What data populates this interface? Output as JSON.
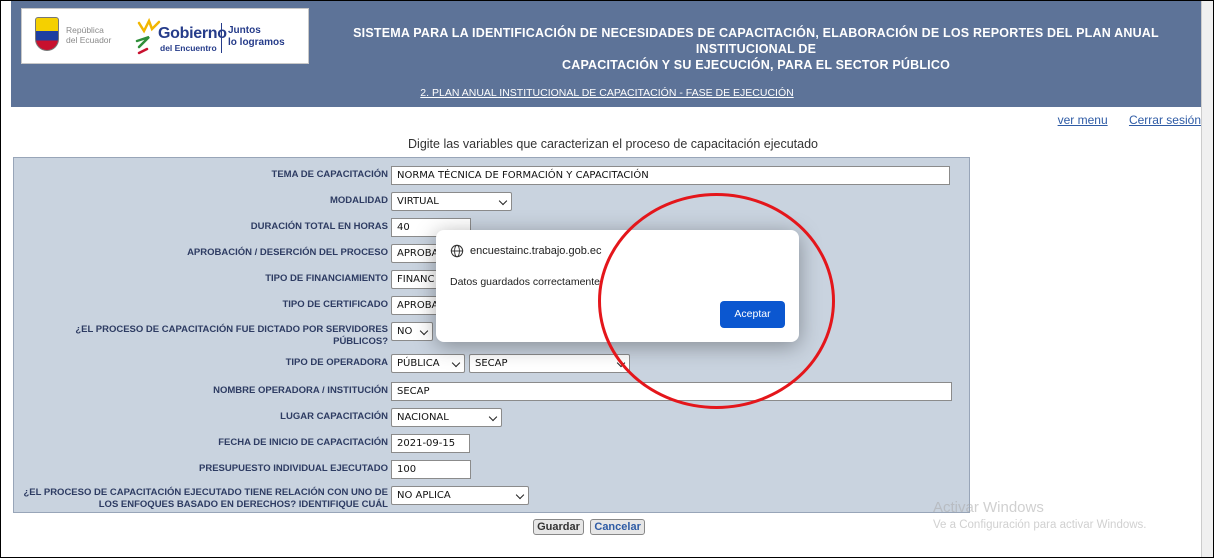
{
  "header": {
    "logo_republica": "República",
    "logo_ecuador": "del Ecuador",
    "logo_gobierno": "Gobierno",
    "logo_encuentro": "del Encuentro",
    "logo_juntos": "Juntos",
    "logo_logramos": "lo logramos",
    "title_line1": "SISTEMA PARA LA IDENTIFICACIÓN DE NECESIDADES DE CAPACITACIÓN, ELABORACIÓN DE LOS REPORTES DEL PLAN ANUAL INSTITUCIONAL DE",
    "title_line2": "CAPACITACIÓN Y SU EJECUCIÓN, PARA EL SECTOR PÚBLICO",
    "phase_link": "2. PLAN ANUAL INSTITUCIONAL DE CAPACITACIÓN - FASE DE EJECUCIÓN"
  },
  "nav": {
    "ver_menu": "ver menu",
    "cerrar_sesion": "Cerrar sesión"
  },
  "instruction": "Digite las variables que caracterizan el proceso de capacitación ejecutado",
  "form": {
    "tema_label": "TEMA DE CAPACITACIÓN",
    "tema_value": "NORMA TÉCNICA DE FORMACIÓN Y CAPACITACIÓN",
    "modalidad_label": "MODALIDAD",
    "modalidad_value": "VIRTUAL",
    "duracion_label": "DURACIÓN TOTAL EN HORAS",
    "duracion_value": "40",
    "aprobacion_label": "APROBACIÓN / DESERCIÓN DEL PROCESO",
    "aprobacion_value": "APROBA",
    "financiamiento_label": "TIPO DE FINANCIAMIENTO",
    "financiamiento_value": "FINANC",
    "certificado_label": "TIPO DE CERTIFICADO",
    "certificado_value": "APROBA",
    "servidores_label_1": "¿EL PROCESO DE CAPACITACIÓN FUE DICTADO POR SERVIDORES",
    "servidores_label_2": "PÚBLICOS?",
    "servidores_value": "NO",
    "operadora_tipo_label": "TIPO DE OPERADORA",
    "operadora_tipo_value": "PÚBLICA",
    "operadora_nombre_sel": "SECAP",
    "operadora_nombre_label": "NOMBRE OPERADORA / INSTITUCIÓN",
    "operadora_nombre_value": "SECAP",
    "lugar_label": "LUGAR CAPACITACIÓN",
    "lugar_value": "NACIONAL",
    "fecha_label": "FECHA DE INICIO DE CAPACITACIÓN",
    "fecha_value": "2021-09-15",
    "presupuesto_label": "PRESUPUESTO INDIVIDUAL EJECUTADO",
    "presupuesto_value": "100",
    "enfoques_label_1": "¿EL PROCESO DE CAPACITACIÓN EJECUTADO TIENE RELACIÓN CON UNO DE",
    "enfoques_label_2": "LOS ENFOQUES BASADO EN DERECHOS? IDENTIFIQUE CUÁL",
    "enfoques_value": "NO APLICA"
  },
  "buttons": {
    "guardar": "Guardar",
    "cancelar": "Cancelar"
  },
  "dialog": {
    "site": "encuestainc.trabajo.gob.ec",
    "message": "Datos guardados correctamente",
    "accept": "Aceptar"
  },
  "watermark": {
    "line1": "Activar Windows",
    "line2": "Ve a Configuración para activar Windows."
  },
  "colors": {
    "header_bg": "#5d7398",
    "form_bg": "#c9d3df",
    "label_text": "#2d3b62",
    "dialog_button": "#0b57d0",
    "annotation": "#e4161b"
  }
}
